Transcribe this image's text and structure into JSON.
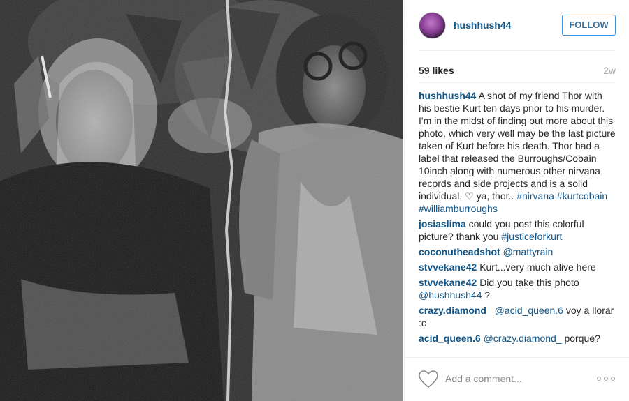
{
  "post": {
    "username": "hushhush44",
    "follow_label": "FOLLOW",
    "likes": "59 likes",
    "time_ago": "2w"
  },
  "caption": {
    "author": "hushhush44",
    "text": "A shot of my friend Thor with his bestie Kurt ten days prior to his murder. I'm in the midst of finding out more about this photo, which very well may be the last picture taken of Kurt before his death. Thor had a label that released the Burroughs/Cobain 10inch along with numerous other nirvana records and side projects and is a solid individual. ♡ ya, thor..",
    "tags": [
      "#nirvana",
      "#kurtcobain",
      "#williamburroughs"
    ]
  },
  "comments": [
    {
      "author": "josiaslima",
      "text": "could you post this colorful picture? thank you",
      "tag": "#justiceforkurt"
    },
    {
      "author": "coconutheadshot",
      "text": "",
      "tag": "@mattyrain"
    },
    {
      "author": "stvvekane42",
      "text": "Kurt...very much alive here",
      "tag": ""
    },
    {
      "author": "stvvekane42",
      "text": "Did you take this photo",
      "tag": "@hushhush44",
      "suffix": " ?"
    },
    {
      "author": "crazy.diamond_",
      "text": "",
      "tag": "@acid_queen.6",
      "suffix": " voy a llorar :c"
    },
    {
      "author": "acid_queen.6",
      "text": "",
      "tag": "@crazy.diamond_",
      "suffix": " porque?"
    }
  ],
  "footer": {
    "placeholder": "Add a comment...",
    "heart_icon": "heart-outline",
    "more_icon": "three-dots"
  },
  "colors": {
    "link": "#125688",
    "follow_border": "#4090db",
    "muted": "#a5a7aa"
  }
}
